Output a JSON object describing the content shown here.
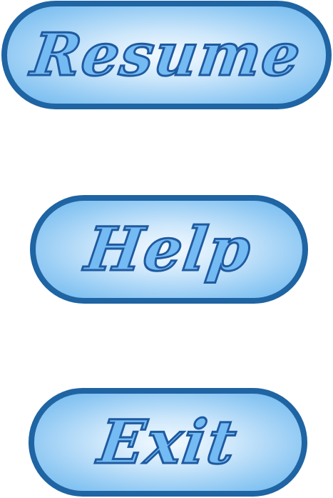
{
  "menu": {
    "resume_label": "Resume",
    "help_label": "Help",
    "exit_label": "Exit"
  },
  "colors": {
    "border": "#1f64a3",
    "fill_center": "#f4faff",
    "fill_edge": "#6db7ee",
    "text_fill": "#74baf3",
    "text_outline": "#1f5aa0"
  }
}
